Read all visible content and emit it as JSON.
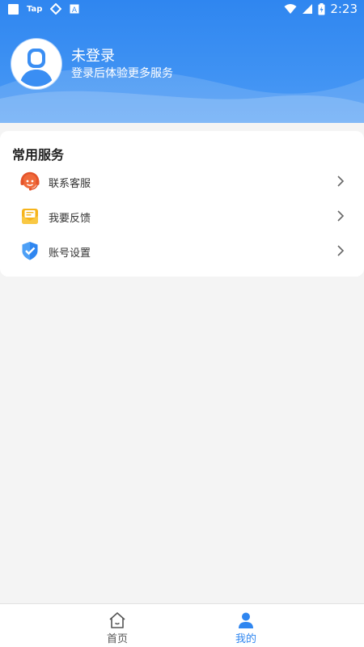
{
  "status_bar": {
    "left_text": "Tap",
    "time": "2:23"
  },
  "profile": {
    "name": "未登录",
    "subtitle": "登录后体验更多服务"
  },
  "services": {
    "title": "常用服务",
    "items": [
      {
        "label": "联系客服",
        "icon": "headset-icon"
      },
      {
        "label": "我要反馈",
        "icon": "feedback-mail-icon"
      },
      {
        "label": "账号设置",
        "icon": "shield-check-icon"
      }
    ]
  },
  "tabbar": {
    "items": [
      {
        "label": "首页",
        "icon": "home-icon",
        "active": false
      },
      {
        "label": "我的",
        "icon": "user-icon",
        "active": true
      }
    ]
  },
  "colors": {
    "primary": "#3a8ef3",
    "background": "#f4f4f4",
    "active_tab": "#2f86f0",
    "inactive_tab": "#555555"
  }
}
